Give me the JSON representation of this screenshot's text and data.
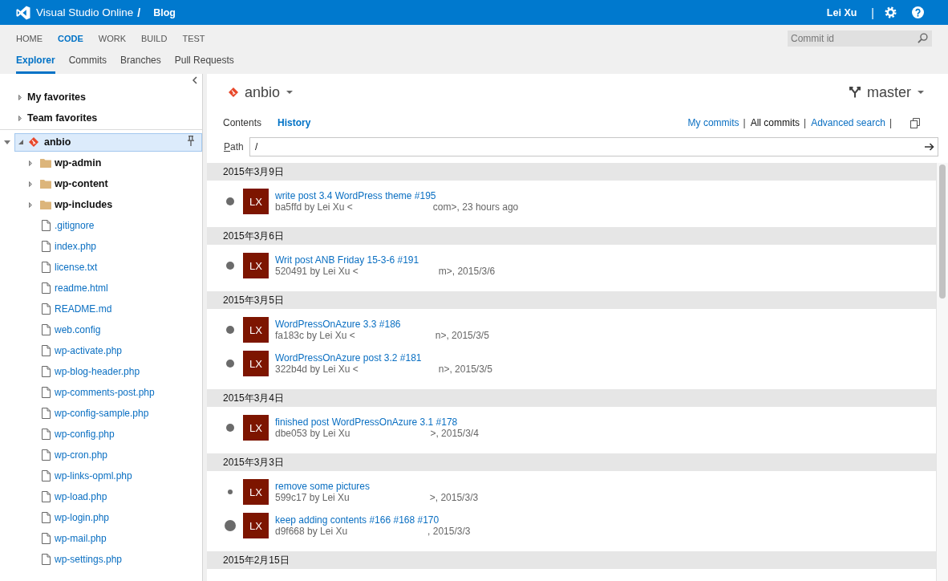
{
  "header": {
    "product": "Visual Studio Online",
    "separator": "/",
    "project": "Blog",
    "user": "Lei Xu",
    "divider": "|"
  },
  "nav": {
    "hubs": [
      {
        "label": "HOME",
        "selected": false
      },
      {
        "label": "CODE",
        "selected": true
      },
      {
        "label": "WORK",
        "selected": false
      },
      {
        "label": "BUILD",
        "selected": false
      },
      {
        "label": "TEST",
        "selected": false
      }
    ],
    "subnav": [
      {
        "label": "Explorer",
        "selected": true
      },
      {
        "label": "Commits",
        "selected": false
      },
      {
        "label": "Branches",
        "selected": false
      },
      {
        "label": "Pull Requests",
        "selected": false
      }
    ],
    "search": {
      "placeholder": "Commit id"
    }
  },
  "sidebar": {
    "favorites": [
      {
        "label": "My favorites",
        "expanded": false,
        "selected": false
      },
      {
        "label": "Team favorites",
        "expanded": false,
        "selected": false
      }
    ],
    "section_expanded": true,
    "repo": {
      "label": "anbio",
      "expanded": true,
      "selected": true,
      "children": [
        {
          "kind": "folder",
          "label": "wp-admin",
          "expanded": false,
          "selected": false
        },
        {
          "kind": "folder",
          "label": "wp-content",
          "expanded": false,
          "selected": false
        },
        {
          "kind": "folder",
          "label": "wp-includes",
          "expanded": false,
          "selected": false
        },
        {
          "kind": "file",
          "label": ".gitignore",
          "selected": false
        },
        {
          "kind": "file",
          "label": "index.php",
          "selected": false
        },
        {
          "kind": "file",
          "label": "license.txt",
          "selected": false
        },
        {
          "kind": "file",
          "label": "readme.html",
          "selected": false
        },
        {
          "kind": "file",
          "label": "README.md",
          "selected": false
        },
        {
          "kind": "file",
          "label": "web.config",
          "selected": false
        },
        {
          "kind": "file",
          "label": "wp-activate.php",
          "selected": false
        },
        {
          "kind": "file",
          "label": "wp-blog-header.php",
          "selected": false
        },
        {
          "kind": "file",
          "label": "wp-comments-post.php",
          "selected": false
        },
        {
          "kind": "file",
          "label": "wp-config-sample.php",
          "selected": false
        },
        {
          "kind": "file",
          "label": "wp-config.php",
          "selected": false
        },
        {
          "kind": "file",
          "label": "wp-cron.php",
          "selected": false
        },
        {
          "kind": "file",
          "label": "wp-links-opml.php",
          "selected": false
        },
        {
          "kind": "file",
          "label": "wp-load.php",
          "selected": false
        },
        {
          "kind": "file",
          "label": "wp-login.php",
          "selected": false
        },
        {
          "kind": "file",
          "label": "wp-mail.php",
          "selected": false
        },
        {
          "kind": "file",
          "label": "wp-settings.php",
          "selected": false
        }
      ]
    }
  },
  "main": {
    "repo": "anbio",
    "branch": "master",
    "tabs": [
      {
        "label": "Contents",
        "selected": false
      },
      {
        "label": "History",
        "selected": true
      }
    ],
    "filters": [
      {
        "label": "My commits",
        "selected": false,
        "separator": "|"
      },
      {
        "label": "All commits",
        "selected": true,
        "separator": "|"
      },
      {
        "label": "Advanced search",
        "selected": false,
        "separator": "|"
      }
    ],
    "path": {
      "label": "Path",
      "value": "/"
    },
    "groups": [
      {
        "date": "2015年3月9日",
        "commits": [
          {
            "kind": "medium",
            "avatar": "LX",
            "title": "write post 3.4 WordPress theme #195",
            "meta_start": "ba5ffd by Lei Xu <",
            "meta_end": "com>, 23 hours ago"
          }
        ]
      },
      {
        "date": "2015年3月6日",
        "commits": [
          {
            "kind": "medium",
            "avatar": "LX",
            "title": "Writ post ANB Friday 15-3-6 #191",
            "meta_start": "520491 by Lei Xu <",
            "meta_end": "m>, 2015/3/6"
          }
        ]
      },
      {
        "date": "2015年3月5日",
        "commits": [
          {
            "kind": "medium",
            "avatar": "LX",
            "title": "WordPressOnAzure 3.3 #186",
            "meta_start": "fa183c by Lei Xu <",
            "meta_end": "n>, 2015/3/5"
          },
          {
            "kind": "medium",
            "avatar": "LX",
            "title": "WordPressOnAzure post 3.2 #181",
            "meta_start": "322b4d by Lei Xu <",
            "meta_end": "n>, 2015/3/5"
          }
        ]
      },
      {
        "date": "2015年3月4日",
        "commits": [
          {
            "kind": "medium",
            "avatar": "LX",
            "title": "finished post WordPressOnAzure 3.1 #178",
            "meta_start": "dbe053 by Lei Xu",
            "meta_end": ">, 2015/3/4"
          }
        ]
      },
      {
        "date": "2015年3月3日",
        "commits": [
          {
            "kind": "small",
            "avatar": "LX",
            "title": "remove some pictures",
            "meta_start": "599c17 by Lei Xu",
            "meta_end": ">, 2015/3/3"
          },
          {
            "kind": "large",
            "avatar": "LX",
            "title": "keep adding contents #166 #168 #170",
            "meta_start": "d9f668 by Lei Xu",
            "meta_end": ", 2015/3/3"
          }
        ]
      },
      {
        "date": "2015年2月15日"
      }
    ]
  }
}
